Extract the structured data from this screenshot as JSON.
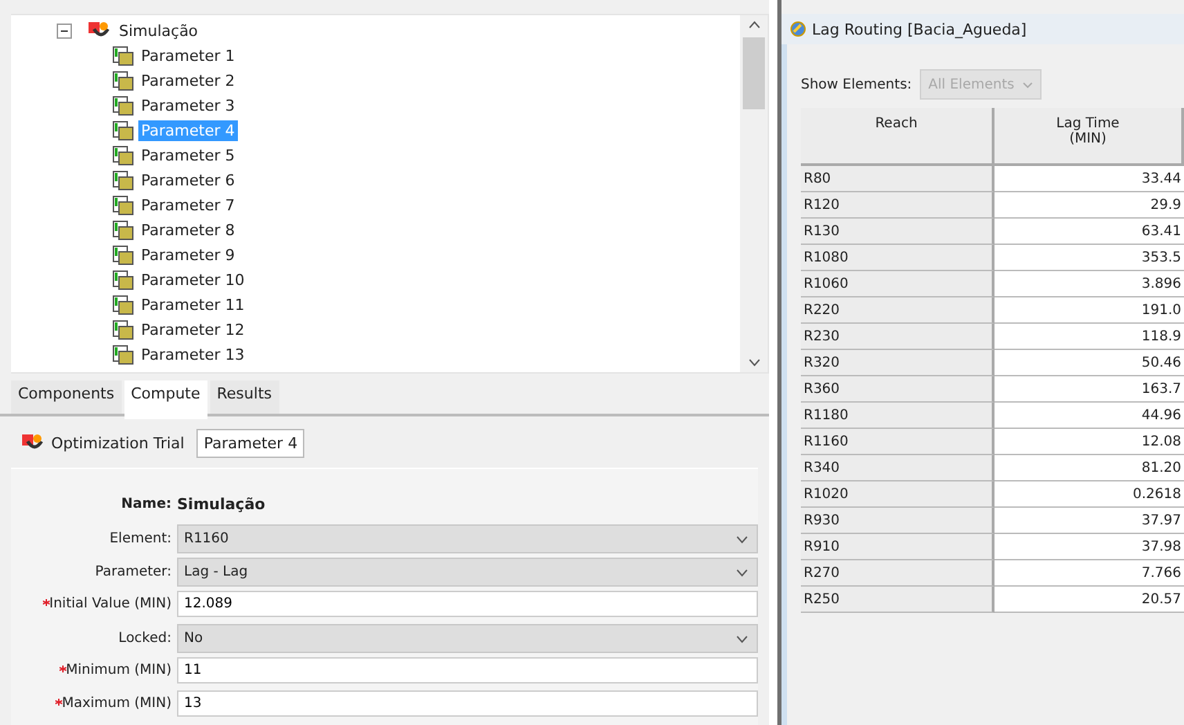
{
  "tree": {
    "label": "Simulação",
    "expanded": true,
    "children": [
      {
        "label": "Parameter 1",
        "selected": false
      },
      {
        "label": "Parameter 2",
        "selected": false
      },
      {
        "label": "Parameter 3",
        "selected": false
      },
      {
        "label": "Parameter 4",
        "selected": true
      },
      {
        "label": "Parameter 5",
        "selected": false
      },
      {
        "label": "Parameter 6",
        "selected": false
      },
      {
        "label": "Parameter 7",
        "selected": false
      },
      {
        "label": "Parameter 8",
        "selected": false
      },
      {
        "label": "Parameter 9",
        "selected": false
      },
      {
        "label": "Parameter 10",
        "selected": false
      },
      {
        "label": "Parameter 11",
        "selected": false
      },
      {
        "label": "Parameter 12",
        "selected": false
      },
      {
        "label": "Parameter 13",
        "selected": false
      }
    ]
  },
  "tabs": [
    {
      "label": "Components",
      "selected": false
    },
    {
      "label": "Compute",
      "selected": true
    },
    {
      "label": "Results",
      "selected": false
    }
  ],
  "editor_tabs": [
    {
      "label": "Optimization Trial",
      "selected": false,
      "kind": "icon"
    },
    {
      "label": "Parameter 4",
      "selected": true,
      "kind": "plain"
    }
  ],
  "form": {
    "name_label": "Name:",
    "name_value": "Simulação",
    "fields": [
      {
        "kind": "select",
        "label": "Element:",
        "value": "R1160",
        "required": false
      },
      {
        "kind": "select",
        "label": "Parameter:",
        "value": "Lag - Lag",
        "required": false
      },
      {
        "kind": "input",
        "label": "Initial Value (MIN)",
        "value": "12.089",
        "required": true
      },
      {
        "kind": "select",
        "label": "Locked:",
        "value": "No",
        "required": false
      },
      {
        "kind": "input",
        "label": "Minimum (MIN)",
        "value": "11",
        "required": true
      },
      {
        "kind": "input",
        "label": "Maximum (MIN)",
        "value": "13",
        "required": true
      }
    ]
  },
  "table_window": {
    "title": "Lag Routing [Bacia_Agueda]",
    "filter": {
      "label": "Show Elements:",
      "value": "All Elements",
      "disabled": true
    },
    "columns": [
      {
        "label": "Reach"
      },
      {
        "label": "Lag Time",
        "unit": "(MIN)"
      }
    ],
    "rows": [
      [
        "R80",
        "33.44"
      ],
      [
        "R120",
        "29.9"
      ],
      [
        "R130",
        "63.41"
      ],
      [
        "R1080",
        "353.5"
      ],
      [
        "R1060",
        "3.896"
      ],
      [
        "R220",
        "191.0"
      ],
      [
        "R230",
        "118.9"
      ],
      [
        "R320",
        "50.46"
      ],
      [
        "R360",
        "163.7"
      ],
      [
        "R1180",
        "44.96"
      ],
      [
        "R1160",
        "12.08"
      ],
      [
        "R340",
        "81.20"
      ],
      [
        "R1020",
        "0.2618"
      ],
      [
        "R930",
        "37.97"
      ],
      [
        "R910",
        "37.98"
      ],
      [
        "R270",
        "7.766"
      ],
      [
        "R250",
        "20.57"
      ]
    ]
  }
}
